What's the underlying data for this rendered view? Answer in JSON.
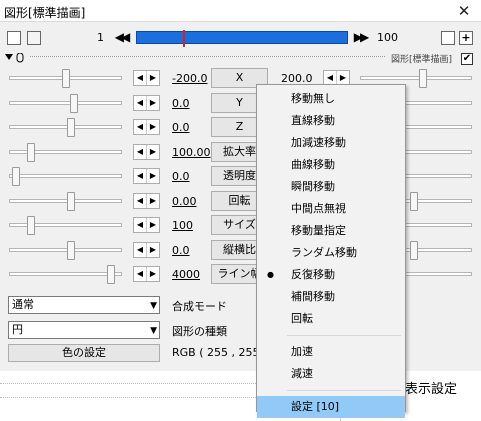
{
  "window": {
    "title": "図形[標準描画]",
    "close_glyph": "✕"
  },
  "toolbar": {
    "frame_start": "1",
    "frame_end": "100",
    "prev_glyph": "◀◀",
    "next_glyph": "▶▶",
    "plus_glyph": "+"
  },
  "object_header": {
    "label": "図形[標準描画]",
    "checked": true,
    "check_glyph": "✔"
  },
  "params": [
    {
      "left": "-200.0",
      "name": "X",
      "right": "200.0"
    },
    {
      "left": "0.0",
      "name": "Y",
      "right": ""
    },
    {
      "left": "0.0",
      "name": "Z",
      "right": ""
    },
    {
      "left": "100.00",
      "name": "拡大率",
      "right": ""
    },
    {
      "left": "0.0",
      "name": "透明度",
      "right": ""
    },
    {
      "left": "0.00",
      "name": "回転",
      "right": ""
    },
    {
      "left": "100",
      "name": "サイズ",
      "right": ""
    },
    {
      "left": "0.0",
      "name": "縦横比",
      "right": ""
    },
    {
      "left": "4000",
      "name": "ライン幅",
      "right": ""
    }
  ],
  "blend": {
    "value": "通常",
    "label": "合成モード"
  },
  "shape": {
    "value": "円",
    "label": "図形の種類"
  },
  "color": {
    "button": "色の設定",
    "rgb": "RGB ( 255 , 255 ,"
  },
  "lower": {
    "display_settings": "表示設定"
  },
  "context_menu": {
    "items": [
      {
        "label": "移動無し",
        "selected": false
      },
      {
        "label": "直線移動",
        "selected": false
      },
      {
        "label": "加減速移動",
        "selected": false
      },
      {
        "label": "曲線移動",
        "selected": false
      },
      {
        "label": "瞬間移動",
        "selected": false
      },
      {
        "label": "中間点無視",
        "selected": false
      },
      {
        "label": "移動量指定",
        "selected": false
      },
      {
        "label": "ランダム移動",
        "selected": false
      },
      {
        "label": "反復移動",
        "selected": true
      },
      {
        "label": "補間移動",
        "selected": false
      },
      {
        "label": "回転",
        "selected": false
      }
    ],
    "accel": "加速",
    "decel": "減速",
    "settings": "設定 [10]",
    "bullet": "●"
  },
  "colors": {
    "timeline": "#1a6fe0",
    "menu_highlight": "#91c9f7"
  }
}
